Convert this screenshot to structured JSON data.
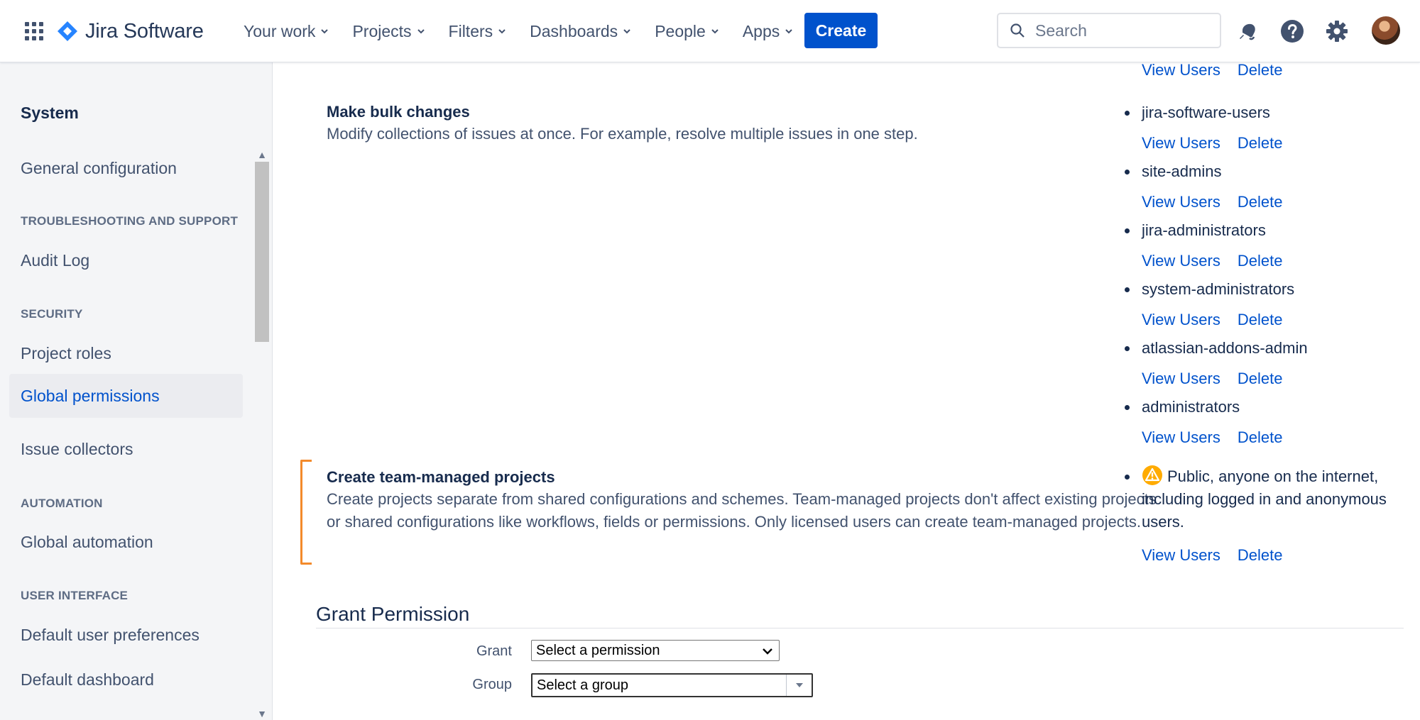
{
  "topnav": {
    "product_name": "Jira Software",
    "menu": [
      {
        "label": "Your work"
      },
      {
        "label": "Projects"
      },
      {
        "label": "Filters"
      },
      {
        "label": "Dashboards"
      },
      {
        "label": "People"
      },
      {
        "label": "Apps"
      }
    ],
    "create_label": "Create",
    "search_placeholder": "Search",
    "icons": [
      "app-switcher-icon",
      "notifications-icon",
      "help-icon",
      "settings-icon",
      "avatar"
    ],
    "brand_color": "#0052cc"
  },
  "sidebar": {
    "title": "System",
    "sections": {
      "top_items": [
        "General configuration"
      ],
      "troubleshooting": {
        "heading": "TROUBLESHOOTING AND SUPPORT",
        "items": [
          "Audit Log"
        ]
      },
      "security": {
        "heading": "SECURITY",
        "items": [
          "Project roles",
          "Global permissions",
          "Issue collectors"
        ]
      },
      "automation": {
        "heading": "AUTOMATION",
        "items": [
          "Global automation"
        ]
      },
      "user_interface": {
        "heading": "USER INTERFACE",
        "items": [
          "Default user preferences",
          "Default dashboard"
        ]
      }
    },
    "active_item": "Global permissions"
  },
  "permissions": [
    {
      "title": "Make bulk changes",
      "description": "Modify collections of issues at once. For example, resolve multiple issues in one step.",
      "groups": [
        "jira-software-users",
        "site-admins",
        "jira-administrators",
        "system-administrators",
        "atlassian-addons-admin",
        "administrators"
      ]
    },
    {
      "title": "Create team-managed projects",
      "description": "Create projects separate from shared configurations and schemes. Team-managed projects don't affect existing projects or shared configurations like workflows, fields or permissions. Only licensed users can create team-managed projects.",
      "groups": [
        "Public, anyone on the internet, including logged in and anonymous users."
      ]
    }
  ],
  "actions": {
    "view_users": "View Users",
    "delete": "Delete"
  },
  "grant": {
    "heading": "Grant Permission",
    "grant_label": "Grant",
    "grant_value": "Select a permission",
    "group_label": "Group",
    "group_value": "Select a group"
  },
  "colors": {
    "link": "#0052cc",
    "highlight": "#f38a2b",
    "warning": "#ffab00"
  }
}
